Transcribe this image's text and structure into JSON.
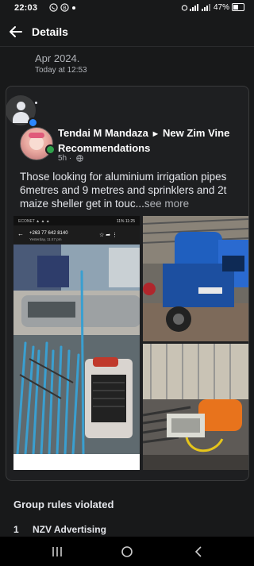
{
  "status_bar": {
    "time": "22:03",
    "battery": "47%",
    "battery_level": 0.47,
    "network_labels": "Vo LTE1 4G",
    "notification_icons": [
      "whatsapp-icon",
      "chat-icon",
      "dot-icon"
    ]
  },
  "app_bar": {
    "title": "Details",
    "back_icon": "arrow-left-icon"
  },
  "report": {
    "date": "Apr 2024.",
    "time": "Today at 12:53"
  },
  "post": {
    "author": "Tendai M Mandaza",
    "group": "New Zim Vine Recommendations",
    "arrow": "►",
    "age": "5h",
    "separator": "·",
    "privacy_icon": "globe-icon",
    "text": "Those looking for aluminium irrigation pipes 6metres and 9 metres and sprinklers and 2t maize sheller get in touc...",
    "see_more": "see more",
    "embedded_screenshot": {
      "phone": "+263 77 642 8140",
      "subtitle": "Yesterday, 11:47 pm",
      "time": "11:25",
      "battery": "11%"
    },
    "images": [
      "irrigation-pipes-photo",
      "maize-sheller-photo",
      "pump-engine-photo"
    ]
  },
  "rules": {
    "title": "Group rules violated",
    "items": [
      {
        "number": "1",
        "label": "NZV Advertising"
      }
    ]
  },
  "nav_bar": {
    "icons": [
      "recent-apps-icon",
      "home-icon",
      "back-icon"
    ]
  },
  "colors": {
    "background": "#18191a",
    "card": "#1e1f21",
    "accent": "#2d88ff",
    "online": "#31a24c"
  }
}
